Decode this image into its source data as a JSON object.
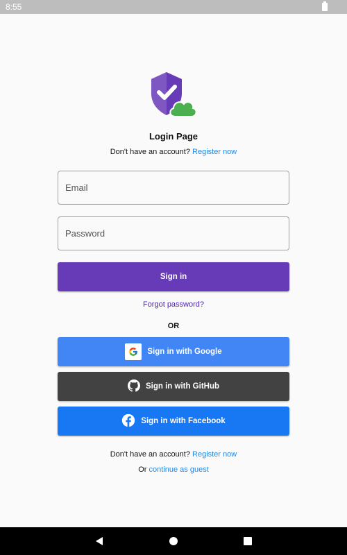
{
  "status_bar": {
    "time": "8:55"
  },
  "page": {
    "title": "Login Page",
    "register_prompt": "Don't have an account?",
    "register_link": "Register now",
    "email_placeholder": "Email",
    "password_placeholder": "Password",
    "signin_label": "Sign in",
    "forgot_label": "Forgot password?",
    "or_label": "OR",
    "google_label": "Sign in with Google",
    "github_label": "Sign in with GitHub",
    "facebook_label": "Sign in with Facebook",
    "bottom_register_prompt": "Don't have an account?",
    "bottom_register_link": "Register now",
    "guest_prefix": "Or",
    "guest_link": "continue as guest"
  },
  "icons": {
    "logo": "shield-check-cloud-icon",
    "google": "google-icon",
    "github": "github-icon",
    "facebook": "facebook-icon",
    "battery": "battery-icon",
    "back": "back-icon",
    "home": "home-icon",
    "recents": "recents-icon"
  },
  "colors": {
    "primary": "#673ab7",
    "google": "#4285f4",
    "github": "#424242",
    "facebook": "#1877f2",
    "link": "#1e88e5"
  }
}
